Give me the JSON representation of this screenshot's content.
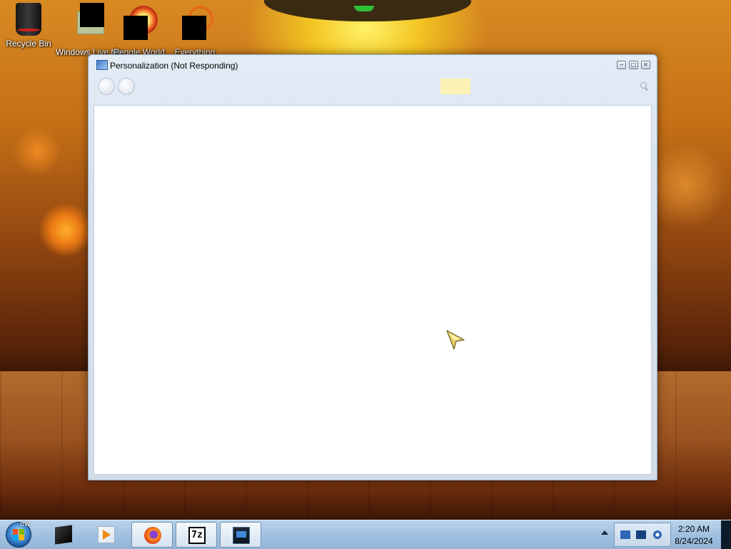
{
  "desktop": {
    "icons": [
      {
        "label": "Recycle Bin",
        "icon": "recycle-bin-icon"
      },
      {
        "label": "Windows Live Ma",
        "icon": "windows-live-mail-icon"
      },
      {
        "label": "Peggle World",
        "icon": "peggle-world-icon"
      },
      {
        "label": "Everything",
        "icon": "everything-search-icon"
      }
    ]
  },
  "window": {
    "title": "Personalization (Not Responding)",
    "controls": {
      "minimize": "minimize-icon",
      "maximize": "maximize-icon",
      "close": "close-icon"
    },
    "toolbar": {
      "back": "back-arrow-icon",
      "forward": "forward-arrow-icon",
      "search": "search-icon"
    }
  },
  "taskbar": {
    "start_label": "ow",
    "items": [
      {
        "icon": "box-app-icon",
        "active": false
      },
      {
        "icon": "media-player-icon",
        "active": false
      },
      {
        "icon": "firefox-icon",
        "active": true
      },
      {
        "icon": "7zip-icon",
        "label": "7z",
        "active": true
      },
      {
        "icon": "control-panel-icon",
        "active": true
      }
    ],
    "tray": {
      "icons": [
        "network-icon",
        "network-icon",
        "volume-icon"
      ]
    },
    "clock": {
      "time": "2:20 AM",
      "date": "8/24/2024"
    }
  }
}
